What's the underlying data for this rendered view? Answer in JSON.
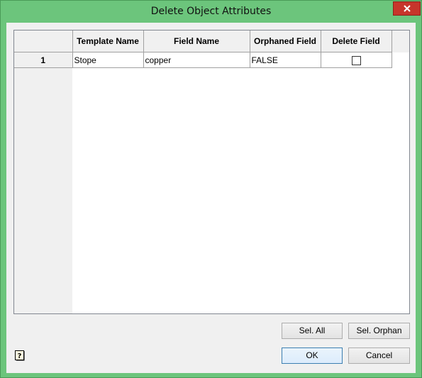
{
  "window": {
    "title": "Delete Object Attributes",
    "close_icon": "close-icon",
    "frame_color": "#6cc57c",
    "close_color": "#c7352b"
  },
  "grid": {
    "columns": [
      "",
      "Template Name",
      "Field Name",
      "Orphaned Field",
      "Delete Field"
    ],
    "rows": [
      {
        "number": "1",
        "template_name": "Stope",
        "field_name": "copper",
        "orphaned_field": "FALSE",
        "delete_field": false
      }
    ]
  },
  "buttons": {
    "select_all": "Sel. All",
    "select_orphan": "Sel. Orphan",
    "ok": "OK",
    "cancel": "Cancel"
  },
  "help": {
    "icon": "help-icon"
  }
}
